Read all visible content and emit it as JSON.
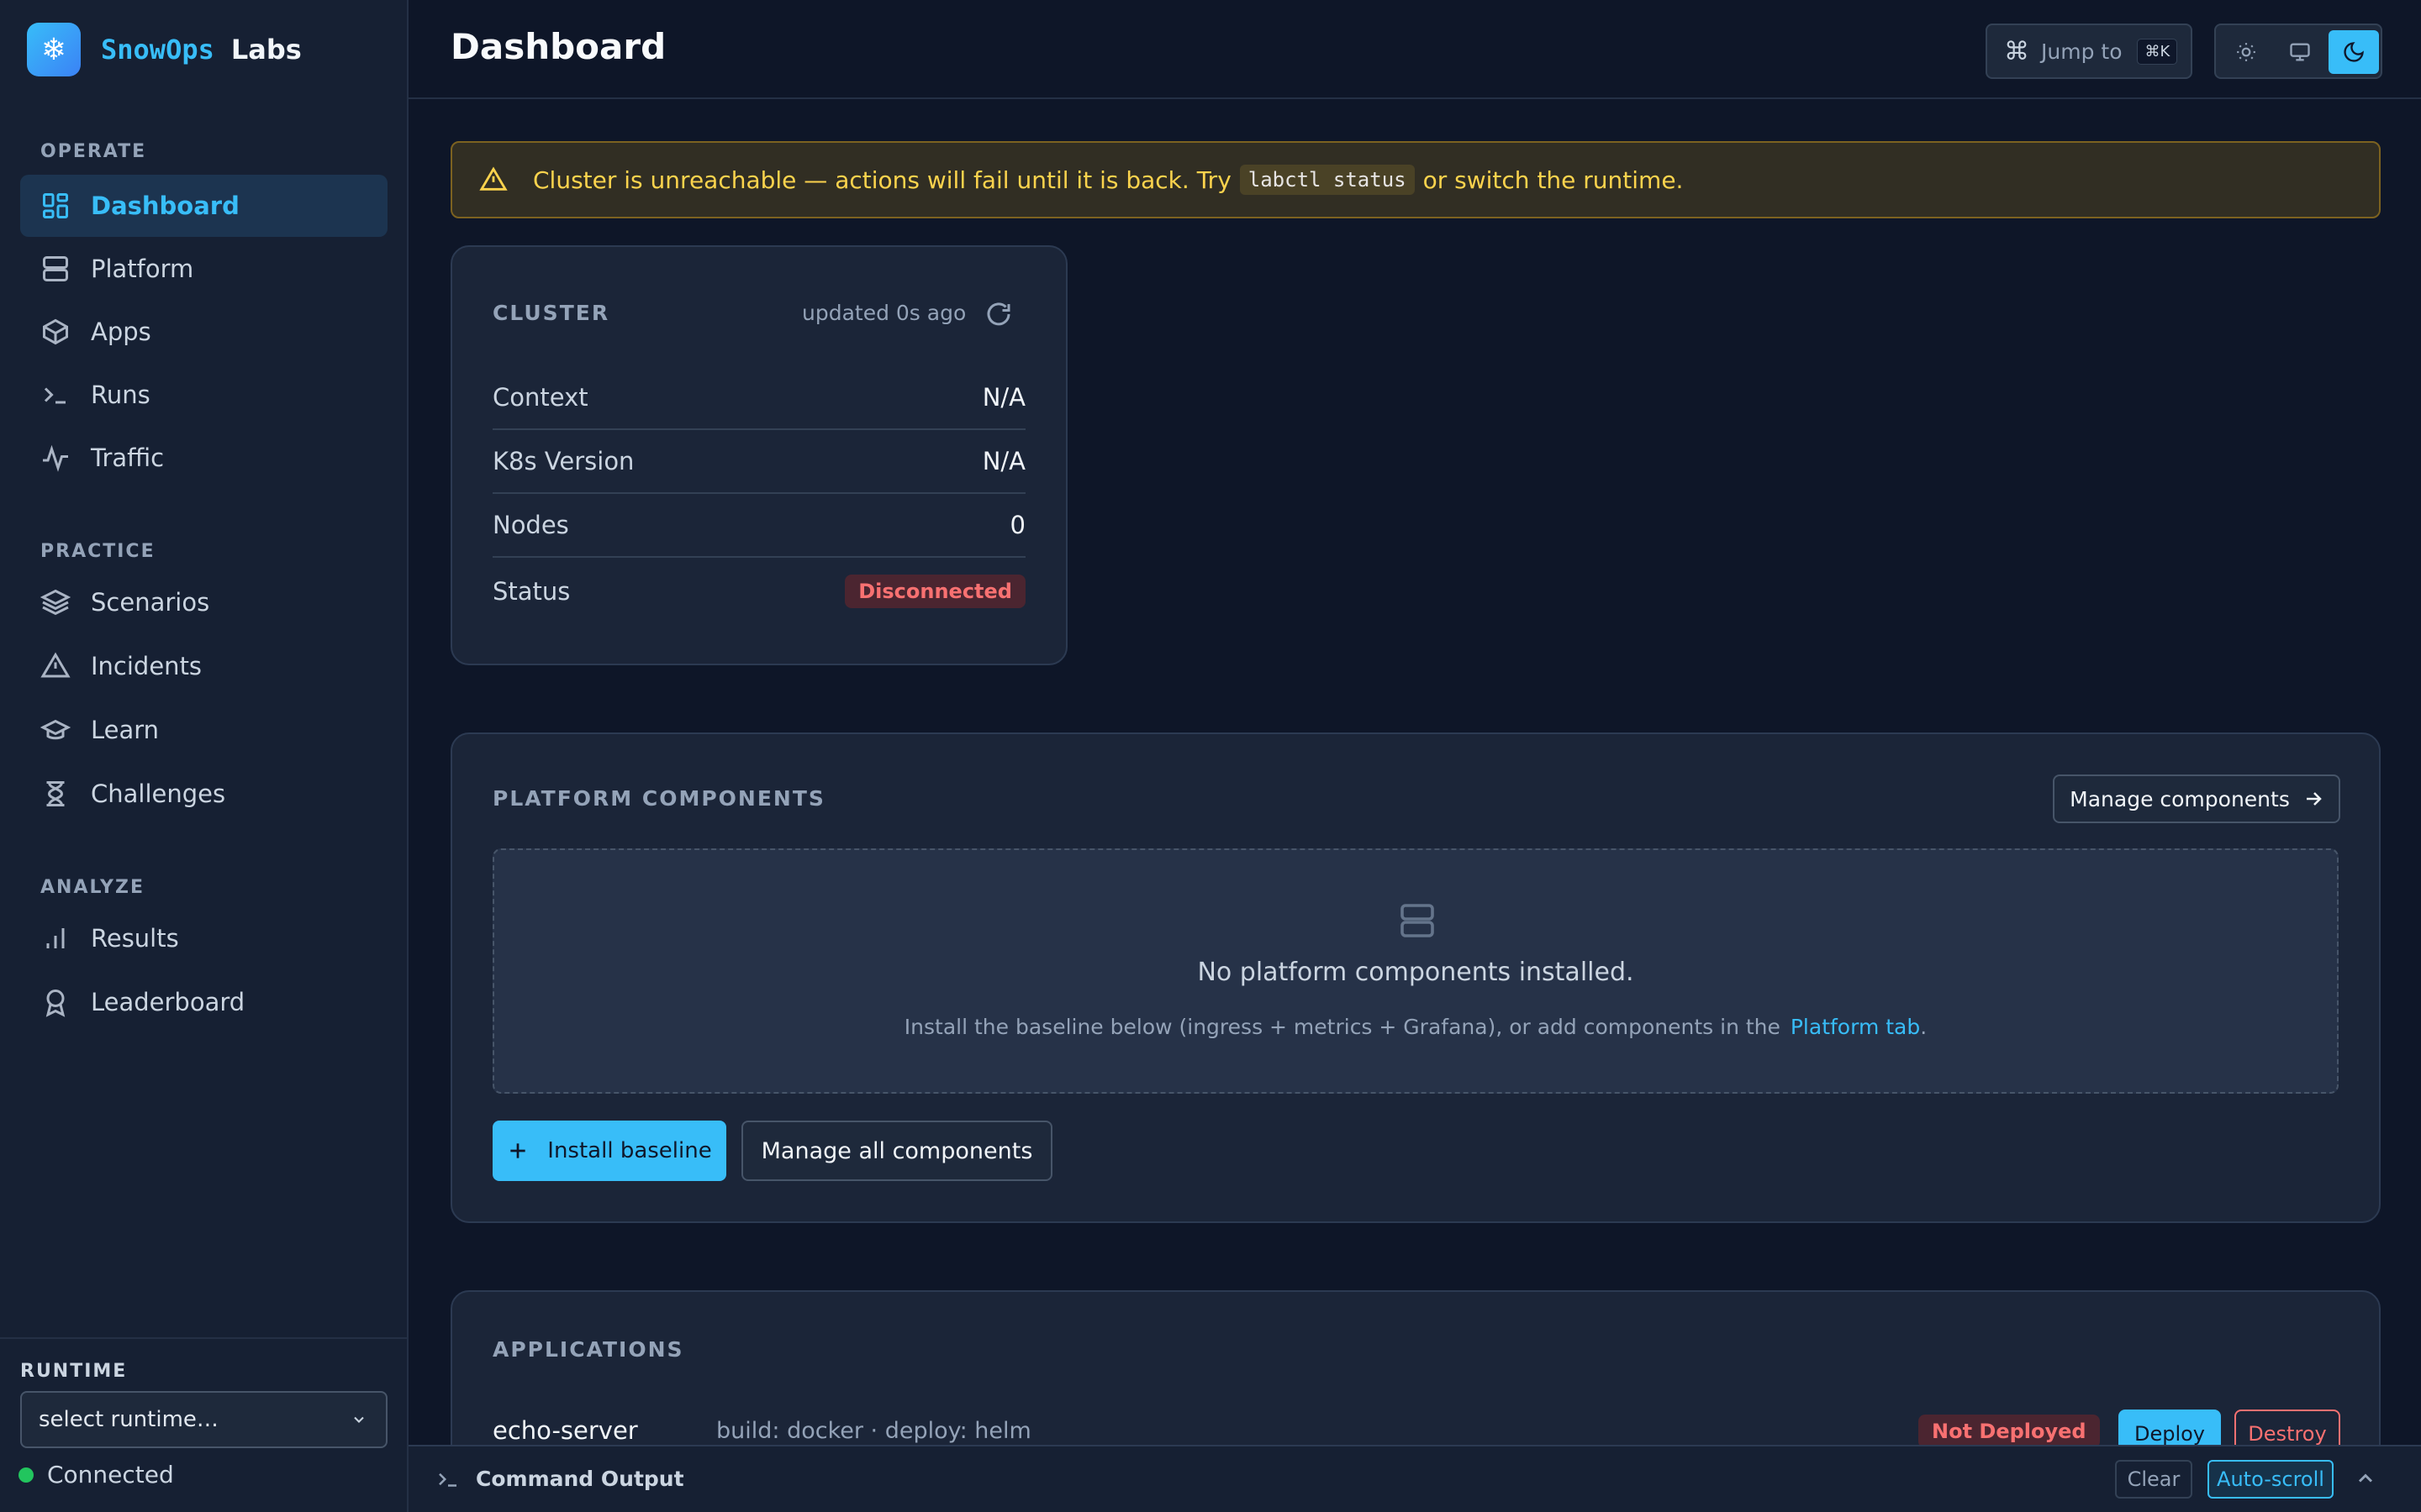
{
  "brand": {
    "name_part1": "SnowOps",
    "name_part2": "Labs",
    "logo_glyph": "❄"
  },
  "sidebar": {
    "sections": [
      {
        "label": "OPERATE",
        "items": [
          {
            "label": "Dashboard",
            "icon": "dashboard-icon",
            "active": true
          },
          {
            "label": "Platform",
            "icon": "server-icon"
          },
          {
            "label": "Apps",
            "icon": "box-icon"
          },
          {
            "label": "Runs",
            "icon": "terminal-icon"
          },
          {
            "label": "Traffic",
            "icon": "activity-icon"
          }
        ]
      },
      {
        "label": "PRACTICE",
        "items": [
          {
            "label": "Scenarios",
            "icon": "layers-icon"
          },
          {
            "label": "Incidents",
            "icon": "warning-icon"
          },
          {
            "label": "Learn",
            "icon": "graduation-cap-icon"
          },
          {
            "label": "Challenges",
            "icon": "hourglass-icon"
          }
        ]
      },
      {
        "label": "ANALYZE",
        "items": [
          {
            "label": "Results",
            "icon": "bar-chart-icon"
          },
          {
            "label": "Leaderboard",
            "icon": "award-icon"
          }
        ]
      }
    ],
    "runtime": {
      "label": "RUNTIME",
      "selected": "select runtime…",
      "status": "Connected"
    }
  },
  "header": {
    "title": "Dashboard",
    "jump_label": "Jump to",
    "jump_shortcut": "⌘K",
    "theme_active": "dark"
  },
  "alert": {
    "text_before": "Cluster is unreachable — actions will fail until it is back. Try",
    "code": "labctl status",
    "text_after": "or switch the runtime."
  },
  "cluster": {
    "title": "CLUSTER",
    "updated": "updated 0s ago",
    "rows": [
      {
        "label": "Context",
        "value": "N/A"
      },
      {
        "label": "K8s Version",
        "value": "N/A"
      },
      {
        "label": "Nodes",
        "value": "0"
      },
      {
        "label": "Status",
        "value": "Disconnected"
      }
    ]
  },
  "platform": {
    "title": "PLATFORM COMPONENTS",
    "manage_button": "Manage components",
    "empty_title": "No platform components installed.",
    "empty_desc_before": "Install the baseline below (ingress + metrics + Grafana), or add components in the",
    "empty_link": "Platform tab",
    "empty_desc_after": ".",
    "install_button": "Install baseline",
    "manage_all_button": "Manage all components"
  },
  "applications": {
    "title": "APPLICATIONS",
    "rows": [
      {
        "name": "echo-server",
        "meta": "build: docker · deploy: helm",
        "status": "Not Deployed",
        "deploy_label": "Deploy",
        "destroy_label": "Destroy"
      }
    ]
  },
  "command_output": {
    "title": "Command Output",
    "clear_label": "Clear",
    "autoscroll_label": "Auto-scroll"
  },
  "colors": {
    "accent": "#38bdf8",
    "warning": "#fcd34d",
    "danger": "#f87171",
    "success": "#22c55e",
    "background": "#0e1628"
  }
}
